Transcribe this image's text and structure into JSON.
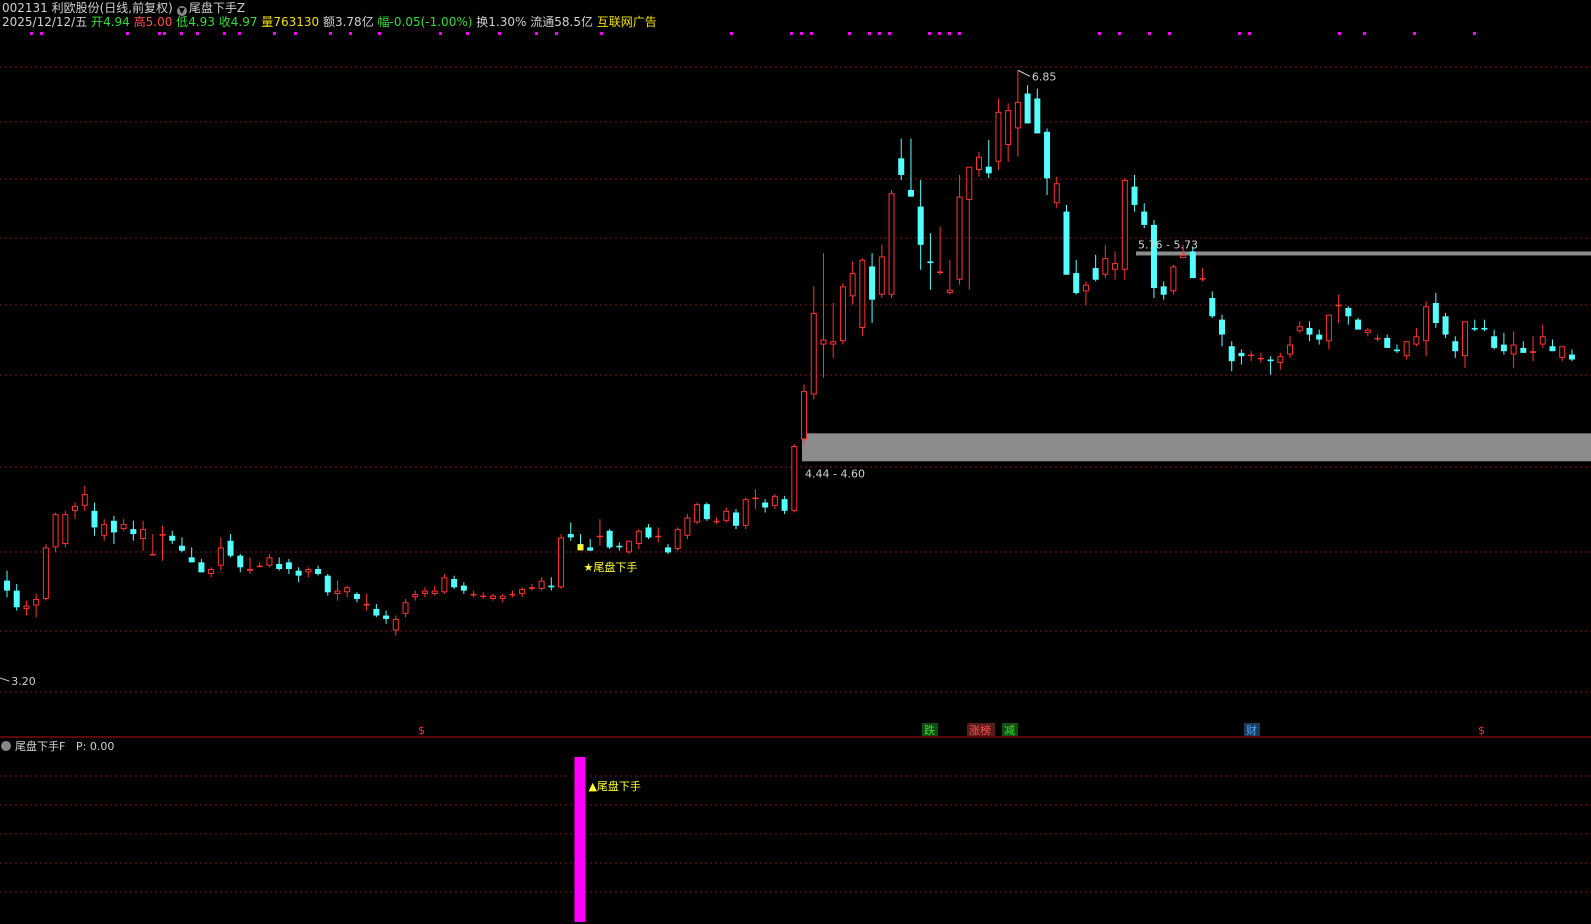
{
  "header": {
    "stock_line": "002131 利欧股份(日线,前复权)",
    "indicator_name": "尾盘下手Z",
    "date": "2025/12/12/五",
    "open_label": "开",
    "open": "4.94",
    "high_label": "高",
    "high": "5.00",
    "low_label": "低",
    "low": "4.93",
    "close_label": "收",
    "close": "4.97",
    "vol_label": "量",
    "vol": "763130",
    "amt_label": "额",
    "amt": "3.78亿",
    "chg_label": "幅",
    "chg": "-0.05(-1.00%)",
    "turn_label": "换",
    "turn": "1.30%",
    "float_label": "流通",
    "float": "58.5亿",
    "concept": "互联网广告"
  },
  "sub_panel": {
    "title": "尾盘下手F",
    "p_label": "P: 0.00",
    "signal_label": "▲尾盘下手"
  },
  "annotations": {
    "high_label": "6.85",
    "low_label": "3.20",
    "zone_upper": "5.76 - 5.73",
    "zone_lower": "4.44 - 4.60",
    "signal_main": "★尾盘下手"
  },
  "event_markers": [
    {
      "text": "$",
      "color": "#ff3030"
    },
    {
      "text": "跌",
      "color": "#33dd33"
    },
    {
      "text": "涨榜",
      "color": "#ff5050"
    },
    {
      "text": "减",
      "color": "#33dd33"
    },
    {
      "text": "财",
      "color": "#4da6ff"
    },
    {
      "text": "$",
      "color": "#ff3030"
    }
  ],
  "colors": {
    "up": "#ff3333",
    "down": "#54ffff",
    "grid": "#7a1a1a",
    "zone": "#8c8c8c",
    "signal_bar": "#ff00ff",
    "signal_text": "#ffff33",
    "top_dots": "#ff00ff"
  },
  "chart_data": {
    "type": "candlestick",
    "ylim": [
      3.05,
      7.05
    ],
    "ohlc": [
      [
        3.78,
        3.84,
        3.68,
        3.72
      ],
      [
        3.72,
        3.76,
        3.6,
        3.62
      ],
      [
        3.61,
        3.66,
        3.57,
        3.63
      ],
      [
        3.63,
        3.7,
        3.56,
        3.67
      ],
      [
        3.67,
        4.0,
        3.66,
        3.98
      ],
      [
        3.98,
        4.19,
        3.95,
        4.18
      ],
      [
        4.0,
        4.2,
        3.98,
        4.18
      ],
      [
        4.2,
        4.25,
        4.15,
        4.23
      ],
      [
        4.23,
        4.35,
        4.2,
        4.3
      ],
      [
        4.2,
        4.25,
        4.05,
        4.1
      ],
      [
        4.05,
        4.15,
        4.02,
        4.12
      ],
      [
        4.14,
        4.17,
        4.0,
        4.07
      ],
      [
        4.09,
        4.15,
        4.08,
        4.12
      ],
      [
        4.09,
        4.14,
        4.02,
        4.06
      ],
      [
        4.03,
        4.14,
        3.96,
        4.09
      ],
      [
        3.94,
        4.06,
        3.94,
        3.94
      ],
      [
        4.05,
        4.11,
        3.9,
        4.06
      ],
      [
        4.05,
        4.08,
        4.0,
        4.02
      ],
      [
        3.99,
        4.04,
        3.95,
        3.96
      ],
      [
        3.92,
        3.98,
        3.89,
        3.89
      ],
      [
        3.89,
        3.91,
        3.83,
        3.83
      ],
      [
        3.82,
        3.86,
        3.8,
        3.85
      ],
      [
        3.87,
        4.04,
        3.84,
        3.98
      ],
      [
        4.02,
        4.06,
        3.92,
        3.93
      ],
      [
        3.93,
        3.94,
        3.83,
        3.86
      ],
      [
        3.84,
        3.92,
        3.82,
        3.85
      ],
      [
        3.87,
        3.89,
        3.86,
        3.87
      ],
      [
        3.87,
        3.94,
        3.86,
        3.92
      ],
      [
        3.88,
        3.92,
        3.84,
        3.85
      ],
      [
        3.89,
        3.91,
        3.82,
        3.85
      ],
      [
        3.84,
        3.86,
        3.77,
        3.81
      ],
      [
        3.83,
        3.86,
        3.8,
        3.85
      ],
      [
        3.85,
        3.87,
        3.81,
        3.82
      ],
      [
        3.81,
        3.82,
        3.69,
        3.71
      ],
      [
        3.7,
        3.78,
        3.66,
        3.72
      ],
      [
        3.71,
        3.75,
        3.68,
        3.74
      ],
      [
        3.7,
        3.71,
        3.65,
        3.67
      ],
      [
        3.63,
        3.7,
        3.6,
        3.64
      ],
      [
        3.61,
        3.64,
        3.56,
        3.57
      ],
      [
        3.57,
        3.6,
        3.52,
        3.55
      ],
      [
        3.48,
        3.57,
        3.45,
        3.55
      ],
      [
        3.58,
        3.67,
        3.56,
        3.65
      ],
      [
        3.68,
        3.72,
        3.66,
        3.7
      ],
      [
        3.7,
        3.74,
        3.68,
        3.72
      ],
      [
        3.7,
        3.75,
        3.69,
        3.72
      ],
      [
        3.71,
        3.82,
        3.7,
        3.8
      ],
      [
        3.79,
        3.81,
        3.73,
        3.74
      ],
      [
        3.75,
        3.77,
        3.7,
        3.72
      ],
      [
        3.7,
        3.72,
        3.68,
        3.7
      ],
      [
        3.69,
        3.71,
        3.67,
        3.69
      ],
      [
        3.67,
        3.7,
        3.66,
        3.69
      ],
      [
        3.67,
        3.7,
        3.65,
        3.69
      ],
      [
        3.7,
        3.72,
        3.68,
        3.7
      ],
      [
        3.7,
        3.74,
        3.68,
        3.73
      ],
      [
        3.73,
        3.76,
        3.72,
        3.74
      ],
      [
        3.73,
        3.8,
        3.72,
        3.78
      ],
      [
        3.75,
        3.8,
        3.72,
        3.74
      ],
      [
        3.74,
        4.06,
        3.73,
        4.04
      ],
      [
        4.06,
        4.13,
        4.02,
        4.04
      ],
      [
        4.0,
        4.06,
        3.97,
        3.98
      ],
      [
        3.98,
        4.03,
        3.96,
        3.96
      ],
      [
        4.05,
        4.15,
        3.99,
        4.05
      ],
      [
        4.08,
        4.09,
        3.97,
        3.98
      ],
      [
        3.99,
        4.01,
        3.96,
        3.98
      ],
      [
        3.95,
        4.02,
        3.94,
        4.02
      ],
      [
        4.0,
        4.09,
        3.97,
        4.08
      ],
      [
        4.1,
        4.12,
        4.03,
        4.04
      ],
      [
        4.05,
        4.1,
        4.01,
        4.05
      ],
      [
        3.98,
        4.0,
        3.94,
        3.95
      ],
      [
        3.97,
        4.1,
        3.96,
        4.09
      ],
      [
        4.05,
        4.18,
        4.03,
        4.16
      ],
      [
        4.13,
        4.25,
        4.12,
        4.24
      ],
      [
        4.24,
        4.25,
        4.14,
        4.15
      ],
      [
        4.14,
        4.16,
        4.12,
        4.14
      ],
      [
        4.14,
        4.22,
        4.13,
        4.2
      ],
      [
        4.19,
        4.21,
        4.09,
        4.11
      ],
      [
        4.11,
        4.28,
        4.09,
        4.27
      ],
      [
        4.27,
        4.33,
        4.21,
        4.28
      ],
      [
        4.25,
        4.27,
        4.19,
        4.22
      ],
      [
        4.23,
        4.3,
        4.21,
        4.29
      ],
      [
        4.27,
        4.29,
        4.18,
        4.2
      ],
      [
        4.2,
        4.6,
        4.19,
        4.59
      ],
      [
        4.63,
        4.96,
        4.6,
        4.92
      ],
      [
        4.9,
        5.55,
        4.87,
        5.39
      ],
      [
        5.2,
        5.75,
        5.0,
        5.23
      ],
      [
        5.2,
        5.45,
        5.12,
        5.22
      ],
      [
        5.22,
        5.57,
        5.2,
        5.55
      ],
      [
        5.49,
        5.7,
        5.44,
        5.63
      ],
      [
        5.3,
        5.72,
        5.25,
        5.71
      ],
      [
        5.67,
        5.75,
        5.33,
        5.47
      ],
      [
        5.5,
        5.8,
        5.48,
        5.73
      ],
      [
        5.5,
        6.13,
        5.48,
        6.11
      ],
      [
        6.32,
        6.44,
        6.19,
        6.22
      ],
      [
        6.13,
        6.44,
        6.09,
        6.09
      ],
      [
        6.03,
        6.19,
        5.65,
        5.8
      ],
      [
        5.7,
        5.87,
        5.53,
        5.69
      ],
      [
        5.63,
        5.91,
        5.62,
        5.64
      ],
      [
        5.51,
        5.71,
        5.5,
        5.53
      ],
      [
        5.59,
        6.22,
        5.56,
        6.09
      ],
      [
        6.07,
        6.16,
        5.53,
        6.27
      ],
      [
        6.25,
        6.36,
        6.21,
        6.33
      ],
      [
        6.27,
        6.43,
        6.2,
        6.23
      ],
      [
        6.3,
        6.68,
        6.25,
        6.6
      ],
      [
        6.4,
        6.65,
        6.3,
        6.61
      ],
      [
        6.5,
        6.85,
        6.33,
        6.66
      ],
      [
        6.71,
        6.76,
        6.55,
        6.53
      ],
      [
        6.68,
        6.74,
        6.5,
        6.47
      ],
      [
        6.48,
        6.5,
        6.1,
        6.2
      ],
      [
        6.05,
        6.21,
        6.02,
        6.17
      ],
      [
        6.0,
        6.04,
        5.62,
        5.62
      ],
      [
        5.63,
        5.71,
        5.5,
        5.51
      ],
      [
        5.52,
        5.58,
        5.44,
        5.56
      ],
      [
        5.66,
        5.74,
        5.58,
        5.59
      ],
      [
        5.62,
        5.8,
        5.6,
        5.72
      ],
      [
        5.65,
        5.76,
        5.59,
        5.69
      ],
      [
        5.65,
        6.2,
        5.59,
        6.19
      ],
      [
        6.15,
        6.22,
        6.0,
        6.04
      ],
      [
        6.0,
        6.05,
        5.9,
        5.92
      ],
      [
        5.92,
        5.95,
        5.48,
        5.54
      ],
      [
        5.55,
        5.58,
        5.47,
        5.5
      ],
      [
        5.52,
        5.68,
        5.5,
        5.67
      ],
      [
        5.72,
        5.8,
        5.72,
        5.74
      ],
      [
        5.76,
        5.79,
        5.6,
        5.6
      ],
      [
        5.6,
        5.66,
        5.58,
        5.6
      ],
      [
        5.48,
        5.52,
        5.36,
        5.37
      ],
      [
        5.35,
        5.38,
        5.19,
        5.26
      ],
      [
        5.19,
        5.22,
        5.04,
        5.1
      ],
      [
        5.15,
        5.17,
        5.08,
        5.13
      ],
      [
        5.14,
        5.16,
        5.1,
        5.14
      ],
      [
        5.12,
        5.15,
        5.09,
        5.12
      ],
      [
        5.11,
        5.13,
        5.02,
        5.1
      ],
      [
        5.09,
        5.15,
        5.05,
        5.13
      ],
      [
        5.14,
        5.25,
        5.12,
        5.2
      ],
      [
        5.28,
        5.34,
        5.27,
        5.31
      ],
      [
        5.3,
        5.34,
        5.22,
        5.26
      ],
      [
        5.26,
        5.29,
        5.2,
        5.23
      ],
      [
        5.22,
        5.38,
        5.17,
        5.38
      ],
      [
        5.43,
        5.5,
        5.33,
        5.44
      ],
      [
        5.42,
        5.43,
        5.32,
        5.37
      ],
      [
        5.35,
        5.36,
        5.29,
        5.29
      ],
      [
        5.27,
        5.3,
        5.25,
        5.29
      ],
      [
        5.24,
        5.26,
        5.22,
        5.24
      ],
      [
        5.24,
        5.26,
        5.18,
        5.18
      ],
      [
        5.17,
        5.2,
        5.15,
        5.16
      ],
      [
        5.13,
        5.22,
        5.11,
        5.22
      ],
      [
        5.2,
        5.3,
        5.19,
        5.25
      ],
      [
        5.22,
        5.46,
        5.13,
        5.43
      ],
      [
        5.45,
        5.51,
        5.3,
        5.33
      ],
      [
        5.37,
        5.39,
        5.24,
        5.26
      ],
      [
        5.22,
        5.25,
        5.12,
        5.16
      ],
      [
        5.13,
        5.34,
        5.06,
        5.34
      ],
      [
        5.3,
        5.35,
        5.28,
        5.29
      ],
      [
        5.3,
        5.35,
        5.28,
        5.29
      ],
      [
        5.25,
        5.29,
        5.17,
        5.18
      ],
      [
        5.2,
        5.27,
        5.14,
        5.16
      ],
      [
        5.14,
        5.28,
        5.06,
        5.2
      ],
      [
        5.18,
        5.22,
        5.15,
        5.15
      ],
      [
        5.15,
        5.25,
        5.1,
        5.16
      ],
      [
        5.2,
        5.32,
        5.18,
        5.25
      ],
      [
        5.19,
        5.23,
        5.16,
        5.16
      ],
      [
        5.12,
        5.19,
        5.1,
        5.19
      ],
      [
        5.14,
        5.17,
        5.1,
        5.11
      ]
    ],
    "high_mark": 6.85,
    "low_mark": 3.2,
    "zone_upper": [
      5.76,
      5.73
    ],
    "zone_lower": [
      4.44,
      4.6
    ],
    "signal_index": 59
  }
}
